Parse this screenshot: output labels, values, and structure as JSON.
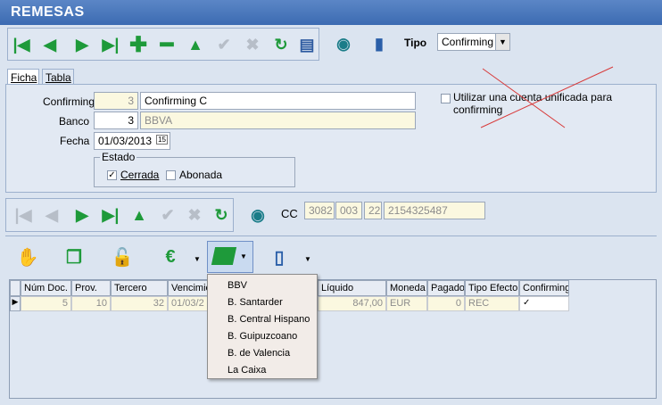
{
  "window": {
    "title": "REMESAS"
  },
  "toolbar": {
    "tipo_label": "Tipo",
    "tipo_value": "Confirming"
  },
  "tabs": [
    {
      "label": "Ficha"
    },
    {
      "label": "Tabla"
    }
  ],
  "form": {
    "confirming_label": "Confirming",
    "confirming_code": "3",
    "confirming_name": "Confirming C",
    "banco_label": "Banco",
    "banco_code": "3",
    "banco_name": "BBVA",
    "fecha_label": "Fecha",
    "fecha_value": "01/03/2013",
    "fecha_icon_text": "15",
    "estado_label": "Estado",
    "cerrada_label": "Cerrada",
    "abonada_label": "Abonada",
    "cuenta_unificada_label": "Utilizar una cuenta unificada para confirming"
  },
  "cc": {
    "label": "CC",
    "entidad": "3082",
    "oficina": "003",
    "dc": "22",
    "cuenta": "2154325487"
  },
  "grid": {
    "headers": [
      "Núm Doc.",
      "Prov.",
      "Tercero",
      "Vencimie",
      "Líquido",
      "Moneda",
      "Pagado",
      "Tipo Efecto",
      "Confirming"
    ],
    "row": {
      "num_doc": "5",
      "prov": "10",
      "tercero": "32",
      "vencimiento": "01/03/2",
      "liquido": "847,00",
      "moneda": "EUR",
      "pagado": "0",
      "tipo_efecto": "REC"
    }
  },
  "dropdown_menu": {
    "items": [
      "BBV",
      "B. Santarder",
      "B. Central Hispano",
      "B. Guipuzcoano",
      "B. de Valencia",
      "La Caixa"
    ]
  },
  "colors": {
    "title_bar": "#3c6bb2",
    "accent_green": "#1e9a3a",
    "readonly_bg": "#fbf8e0"
  }
}
